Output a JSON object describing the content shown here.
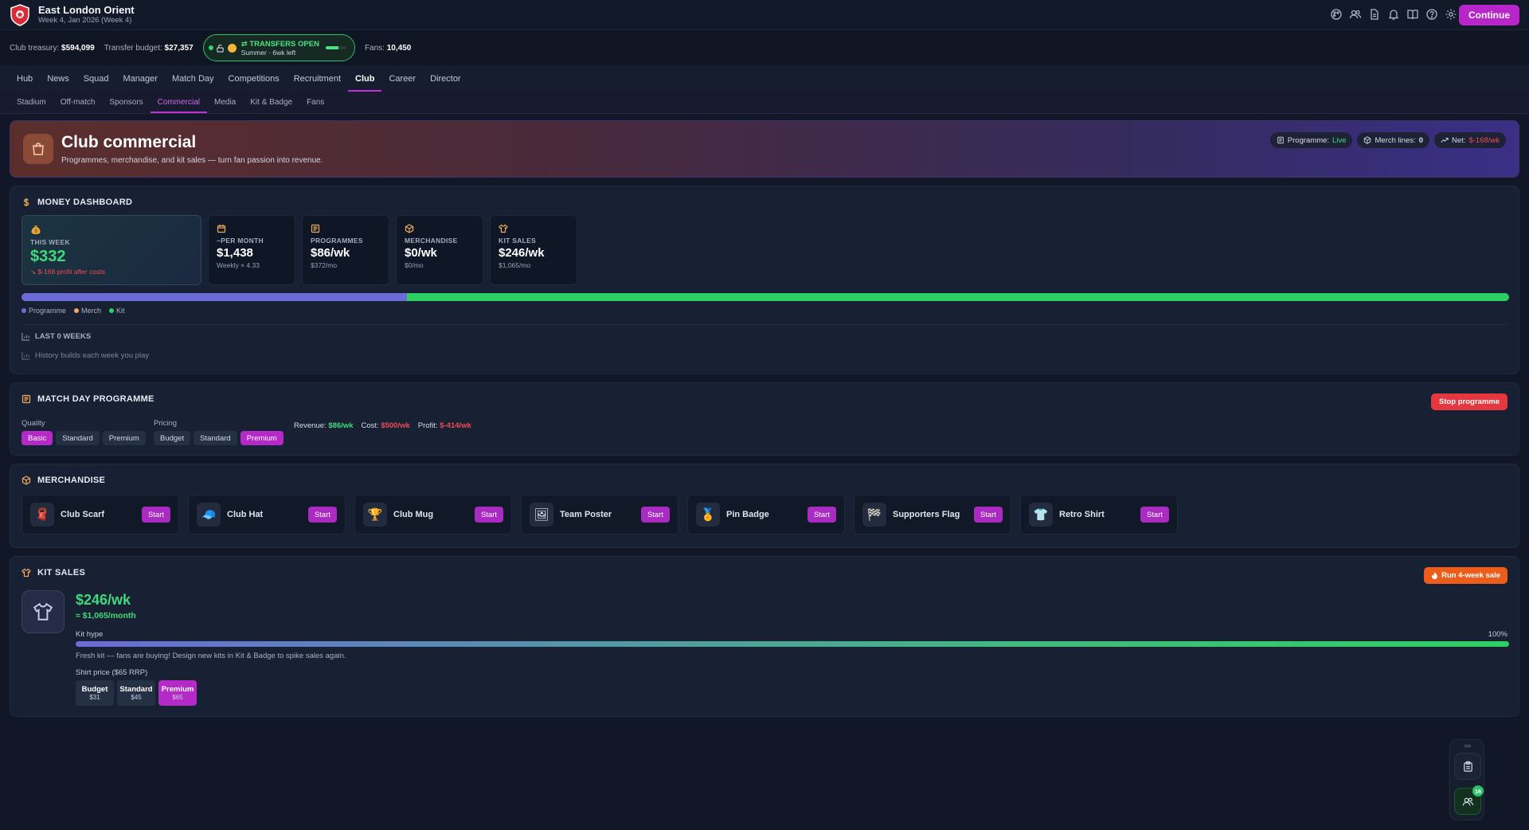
{
  "app": {
    "club_name": "East London Orient",
    "week_label": "Week 4, Jan 2026 (Week 4)",
    "continue_label": "Continue"
  },
  "finance": {
    "treasury_label": "Club treasury:",
    "treasury_value": "$594,099",
    "transfer_budget_label": "Transfer budget:",
    "transfer_budget_value": "$27,357",
    "transfers_title": "TRANSFERS OPEN",
    "transfers_sub": "Summer · 6wk left",
    "transfer_window_progress": 0.6,
    "fans_label": "Fans:",
    "fans_value": "10,450"
  },
  "nav": {
    "items": [
      "Hub",
      "News",
      "Squad",
      "Manager",
      "Match Day",
      "Competitions",
      "Recruitment",
      "Club",
      "Career",
      "Director"
    ],
    "active": "Club"
  },
  "subnav": {
    "items": [
      "Stadium",
      "Off-match",
      "Sponsors",
      "Commercial",
      "Media",
      "Kit & Badge",
      "Fans"
    ],
    "active": "Commercial"
  },
  "hero": {
    "title": "Club commercial",
    "subtitle": "Programmes, merchandise, and kit sales — turn fan passion into revenue.",
    "programme_label": "Programme:",
    "programme_value": "Live",
    "merch_label": "Merch lines:",
    "merch_value": "0",
    "net_label": "Net:",
    "net_value": "$-168/wk"
  },
  "money": {
    "title": "MONEY DASHBOARD",
    "cards": [
      {
        "label": "THIS WEEK",
        "value": "$332",
        "sub": "$-168 profit after costs",
        "icon": "money-bag-icon"
      },
      {
        "label": "~PER MONTH",
        "value": "$1,438",
        "sub": "Weekly × 4.33",
        "icon": "calendar-icon"
      },
      {
        "label": "PROGRAMMES",
        "value": "$86/wk",
        "sub": "$372/mo",
        "icon": "newspaper-icon"
      },
      {
        "label": "MERCHANDISE",
        "value": "$0/wk",
        "sub": "$0/mo",
        "icon": "box-icon"
      },
      {
        "label": "KIT SALES",
        "value": "$246/wk",
        "sub": "$1,065/mo",
        "icon": "shirt-icon"
      }
    ],
    "breakdown": [
      {
        "name": "Programme",
        "value": 86,
        "color": "#6b6cd6"
      },
      {
        "name": "Merch",
        "value": 0,
        "color": "#f0a95c"
      },
      {
        "name": "Kit",
        "value": 246,
        "color": "#2ecf62"
      }
    ],
    "history_title": "LAST 0 WEEKS",
    "history_empty": "History builds each week you play"
  },
  "programme": {
    "title": "MATCH DAY PROGRAMME",
    "stop_label": "Stop programme",
    "quality_label": "Quality",
    "quality_options": [
      "Basic",
      "Standard",
      "Premium"
    ],
    "quality_selected": "Basic",
    "pricing_label": "Pricing",
    "pricing_options": [
      "Budget",
      "Standard",
      "Premium"
    ],
    "pricing_selected": "Premium",
    "revenue_label": "Revenue:",
    "revenue_value": "$86/wk",
    "cost_label": "Cost:",
    "cost_value": "$500/wk",
    "profit_label": "Profit:",
    "profit_value": "$-414/wk"
  },
  "merch": {
    "title": "MERCHANDISE",
    "start_label": "Start",
    "items": [
      {
        "name": "Club Scarf",
        "icon": "scarf-icon"
      },
      {
        "name": "Club Hat",
        "icon": "hat-icon"
      },
      {
        "name": "Club Mug",
        "icon": "trophy-mug-icon"
      },
      {
        "name": "Team Poster",
        "icon": "poster-icon"
      },
      {
        "name": "Pin Badge",
        "icon": "medal-icon"
      },
      {
        "name": "Supporters Flag",
        "icon": "flag-icon"
      },
      {
        "name": "Retro Shirt",
        "icon": "retro-shirt-icon"
      }
    ]
  },
  "kit": {
    "title": "KIT SALES",
    "sale_label": "Run 4-week sale",
    "weekly": "$246/wk",
    "monthly": "≈ $1,065/month",
    "hype_label": "Kit hype",
    "hype_pct_label": "100%",
    "hype_value": 1.0,
    "note": "Fresh kit — fans are buying! Design new kits in Kit & Badge to spike sales again.",
    "price_label": "Shirt price ($65 RRP)",
    "price_options": [
      {
        "name": "Budget",
        "price": "$31"
      },
      {
        "name": "Standard",
        "price": "$45"
      },
      {
        "name": "Premium",
        "price": "$65"
      }
    ],
    "price_selected": "Premium"
  },
  "dock": {
    "badge": "16"
  }
}
